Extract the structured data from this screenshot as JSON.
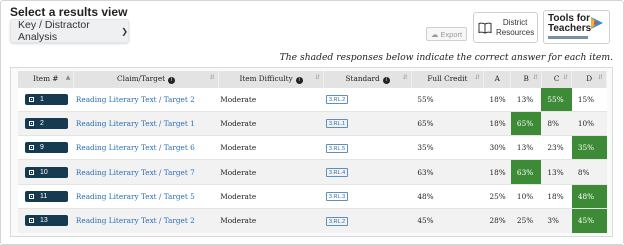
{
  "header": {
    "view_title": "Select a results view",
    "view_select": "Key / Distractor Analysis",
    "export_label": "Export",
    "district_resources_line1": "District",
    "district_resources_line2": "Resources",
    "logo_line1": "Tools for",
    "logo_line2": "Teachers"
  },
  "caption": "The shaded responses below indicate the correct answer for each item.",
  "table": {
    "columns": [
      "Item #",
      "Claim/Target",
      "Item Difficulty",
      "Standard",
      "Full Credit",
      "A",
      "B",
      "C",
      "D"
    ],
    "rows": [
      {
        "item": "1",
        "claim": "Reading Literary Text / Target 2",
        "difficulty": "Moderate",
        "standard": "3.RL.2",
        "full_credit": "55%",
        "a": "18%",
        "b": "13%",
        "c": "55%",
        "d": "15%",
        "correct": "c"
      },
      {
        "item": "2",
        "claim": "Reading Literary Text / Target 1",
        "difficulty": "Moderate",
        "standard": "3.RL.1",
        "full_credit": "65%",
        "a": "18%",
        "b": "65%",
        "c": "8%",
        "d": "10%",
        "correct": "b"
      },
      {
        "item": "9",
        "claim": "Reading Literary Text / Target 6",
        "difficulty": "Moderate",
        "standard": "3.RL.5",
        "full_credit": "35%",
        "a": "30%",
        "b": "13%",
        "c": "23%",
        "d": "35%",
        "correct": "d"
      },
      {
        "item": "10",
        "claim": "Reading Literary Text / Target 7",
        "difficulty": "Moderate",
        "standard": "3.RL.4",
        "full_credit": "63%",
        "a": "18%",
        "b": "63%",
        "c": "13%",
        "d": "8%",
        "correct": "b"
      },
      {
        "item": "11",
        "claim": "Reading Literary Text / Target 5",
        "difficulty": "Moderate",
        "standard": "3.RL.3",
        "full_credit": "48%",
        "a": "25%",
        "b": "10%",
        "c": "18%",
        "d": "48%",
        "correct": "d"
      },
      {
        "item": "13",
        "claim": "Reading Literary Text / Target 2",
        "difficulty": "Moderate",
        "standard": "3.RL.2",
        "full_credit": "45%",
        "a": "28%",
        "b": "25%",
        "c": "3%",
        "d": "45%",
        "correct": "d"
      }
    ]
  },
  "colors": {
    "correct_fill": "#3d8b37",
    "item_button": "#163a50",
    "link": "#2a6fb3"
  }
}
